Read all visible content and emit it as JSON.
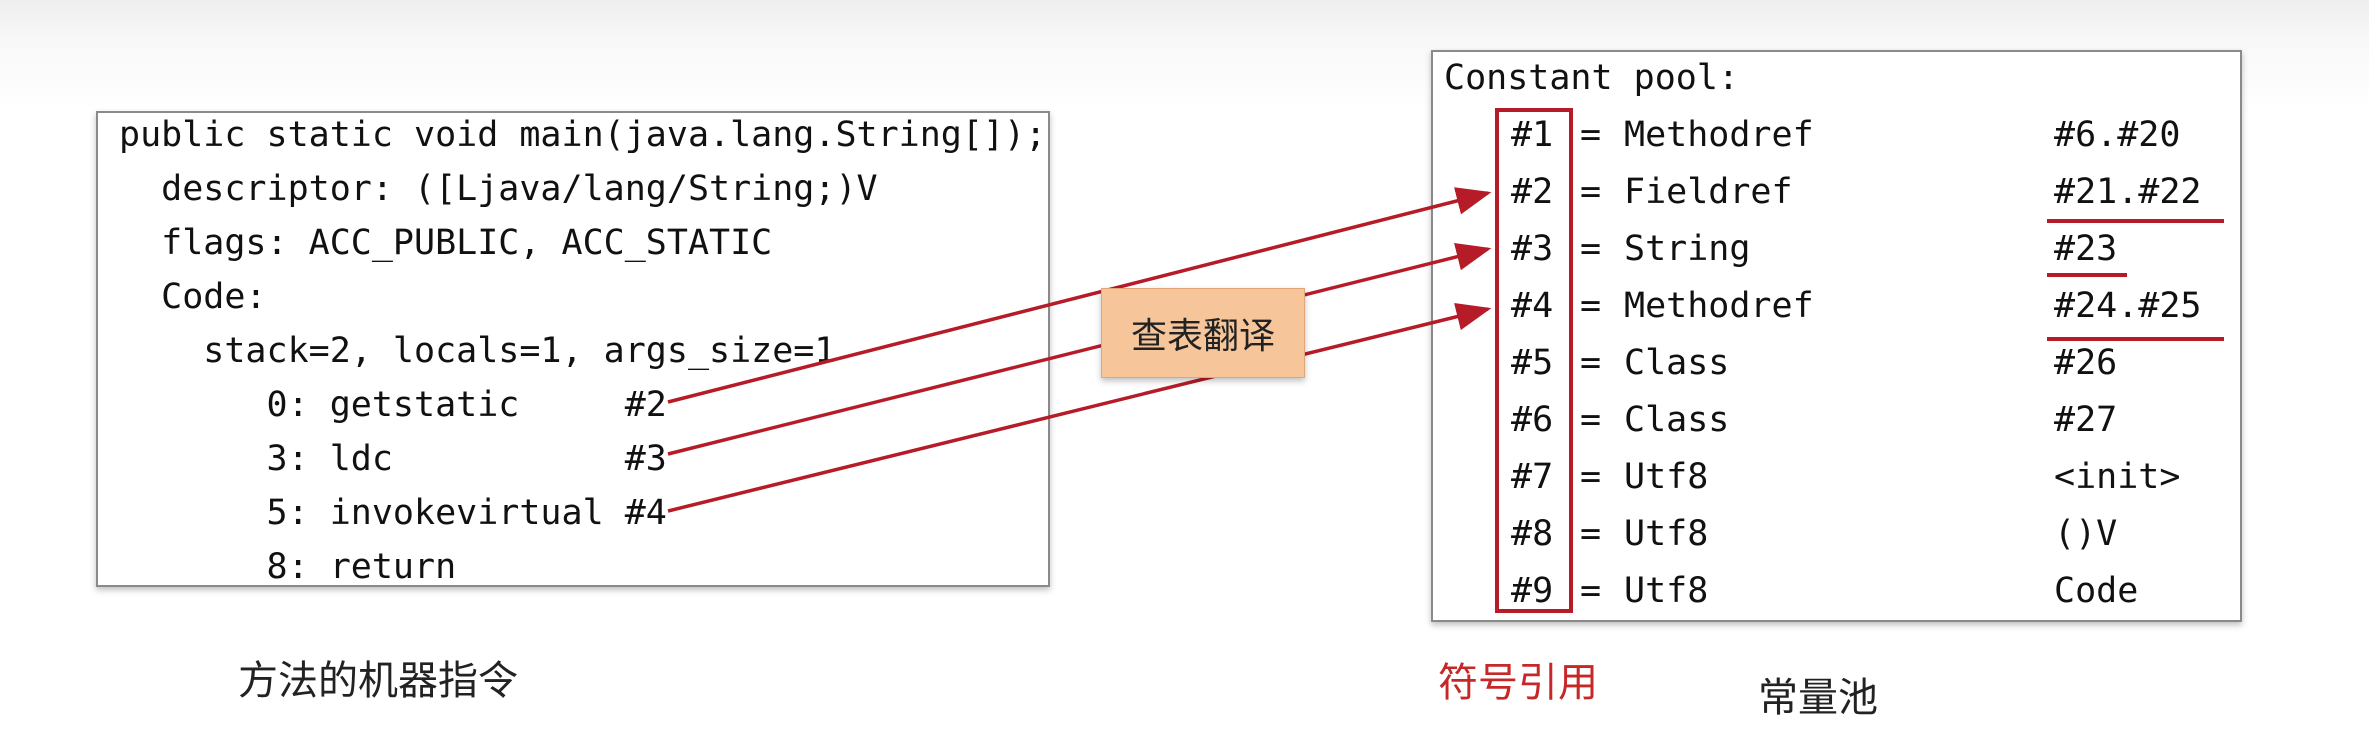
{
  "method_code": {
    "caption": "方法的机器指令",
    "lines": [
      "public static void main(java.lang.String[]);",
      "  descriptor: ([Ljava/lang/String;)V",
      "  flags: ACC_PUBLIC, ACC_STATIC",
      "  Code:",
      "    stack=2, locals=1, args_size=1",
      "       0: getstatic     #2",
      "       3: ldc           #3",
      "       5: invokevirtual #4",
      "       8: return"
    ]
  },
  "badge": {
    "label": "查表翻译"
  },
  "constant_pool": {
    "title": "Constant pool:",
    "caption": "常量池",
    "symbol_ref_caption": "符号引用",
    "rows": [
      {
        "index": "#1",
        "eq": "=",
        "type": "Methodref",
        "value": "#6.#20"
      },
      {
        "index": "#2",
        "eq": "=",
        "type": "Fieldref",
        "value": "#21.#22"
      },
      {
        "index": "#3",
        "eq": "=",
        "type": "String",
        "value": "#23"
      },
      {
        "index": "#4",
        "eq": "=",
        "type": "Methodref",
        "value": "#24.#25"
      },
      {
        "index": "#5",
        "eq": "=",
        "type": "Class",
        "value": "#26"
      },
      {
        "index": "#6",
        "eq": "=",
        "type": "Class",
        "value": "#27"
      },
      {
        "index": "#7",
        "eq": "=",
        "type": "Utf8",
        "value": "<init>"
      },
      {
        "index": "#8",
        "eq": "=",
        "type": "Utf8",
        "value": "()V"
      },
      {
        "index": "#9",
        "eq": "=",
        "type": "Utf8",
        "value": "Code"
      }
    ]
  },
  "colors": {
    "accent": "#b61b28",
    "badge": "#f6c59a"
  }
}
